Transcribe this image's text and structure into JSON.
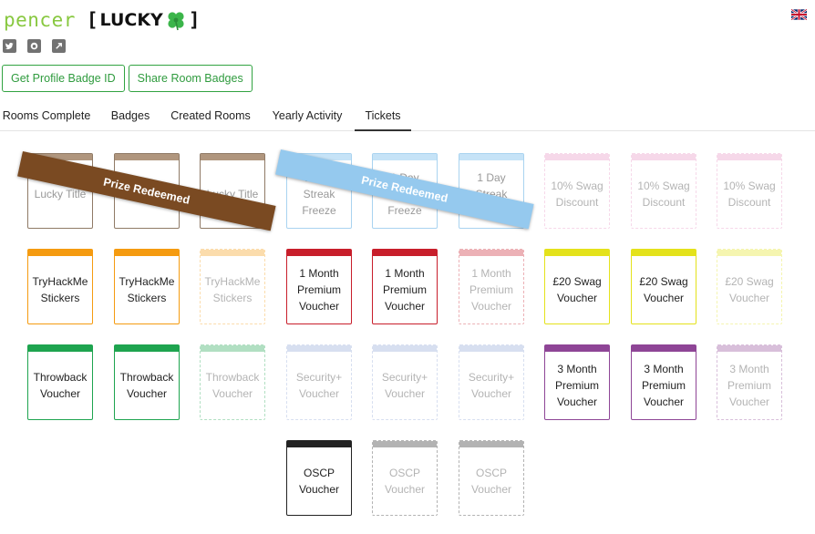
{
  "profile": {
    "username": "pencer",
    "rank_open": "[",
    "rank_label": "LUCKY",
    "rank_close": "]"
  },
  "icons": {
    "flag": "uk-flag-icon",
    "twitter": "twitter-icon",
    "github": "github-icon",
    "external": "external-link-icon",
    "rank": "four-leaf-clover-icon"
  },
  "buttons": {
    "badge_id": "Get Profile Badge ID",
    "share": "Share Room Badges"
  },
  "tabs": [
    "Rooms Complete",
    "Badges",
    "Created Rooms",
    "Yearly Activity",
    "Tickets"
  ],
  "active_tab": "Tickets",
  "colors": {
    "accent_green": "#31a341",
    "lucky": "#8d6a4a",
    "streak": "#91c5ea",
    "swag10": "#e58ec0",
    "stickers": "#f59b10",
    "premium1": "#c81e2b",
    "swag20": "#e4e21b",
    "throwback": "#1ea44f",
    "security": "#8da3d5",
    "premium3": "#8e4596",
    "oscp": "#222222"
  },
  "ribbons": {
    "lucky": "Prize Redeemed",
    "streak": "Prize Redeemed"
  },
  "tickets": [
    {
      "label": "Lucky Title",
      "color": "#8d6a4a",
      "state": "redeemed"
    },
    {
      "label": "Lucky Title",
      "color": "#8d6a4a",
      "state": "redeemed"
    },
    {
      "label": "Lucky Title",
      "color": "#8d6a4a",
      "state": "redeemed"
    },
    {
      "label": "1 Day Streak Freeze",
      "color": "#91c5ea",
      "state": "redeemed"
    },
    {
      "label": "1 Day Streak Freeze",
      "color": "#91c5ea",
      "state": "redeemed"
    },
    {
      "label": "1 Day Streak Freeze",
      "color": "#91c5ea",
      "state": "redeemed"
    },
    {
      "label": "10% Swag Discount",
      "color": "#e58ec0",
      "state": "locked"
    },
    {
      "label": "10% Swag Discount",
      "color": "#e58ec0",
      "state": "locked"
    },
    {
      "label": "10% Swag Discount",
      "color": "#e58ec0",
      "state": "locked"
    },
    {
      "label": "TryHackMe Stickers",
      "color": "#f59b10",
      "state": "won"
    },
    {
      "label": "TryHackMe Stickers",
      "color": "#f59b10",
      "state": "won"
    },
    {
      "label": "TryHackMe Stickers",
      "color": "#f59b10",
      "state": "locked"
    },
    {
      "label": "1 Month Premium Voucher",
      "color": "#c81e2b",
      "state": "won"
    },
    {
      "label": "1 Month Premium Voucher",
      "color": "#c81e2b",
      "state": "won"
    },
    {
      "label": "1 Month Premium Voucher",
      "color": "#c81e2b",
      "state": "locked"
    },
    {
      "label": "£20 Swag Voucher",
      "color": "#e4e21b",
      "state": "won"
    },
    {
      "label": "£20 Swag Voucher",
      "color": "#e4e21b",
      "state": "won"
    },
    {
      "label": "£20 Swag Voucher",
      "color": "#e4e21b",
      "state": "locked"
    },
    {
      "label": "Throwback Voucher",
      "color": "#1ea44f",
      "state": "won"
    },
    {
      "label": "Throwback Voucher",
      "color": "#1ea44f",
      "state": "won"
    },
    {
      "label": "Throwback Voucher",
      "color": "#1ea44f",
      "state": "locked"
    },
    {
      "label": "Security+ Voucher",
      "color": "#8da3d5",
      "state": "locked"
    },
    {
      "label": "Security+ Voucher",
      "color": "#8da3d5",
      "state": "locked"
    },
    {
      "label": "Security+ Voucher",
      "color": "#8da3d5",
      "state": "locked"
    },
    {
      "label": "3 Month Premium Voucher",
      "color": "#8e4596",
      "state": "won"
    },
    {
      "label": "3 Month Premium Voucher",
      "color": "#8e4596",
      "state": "won"
    },
    {
      "label": "3 Month Premium Voucher",
      "color": "#8e4596",
      "state": "locked"
    },
    {
      "label": "OSCP Voucher",
      "color": "#222222",
      "state": "won"
    },
    {
      "label": "OSCP Voucher",
      "color": "#222222",
      "state": "locked"
    },
    {
      "label": "OSCP Voucher",
      "color": "#222222",
      "state": "locked"
    }
  ]
}
